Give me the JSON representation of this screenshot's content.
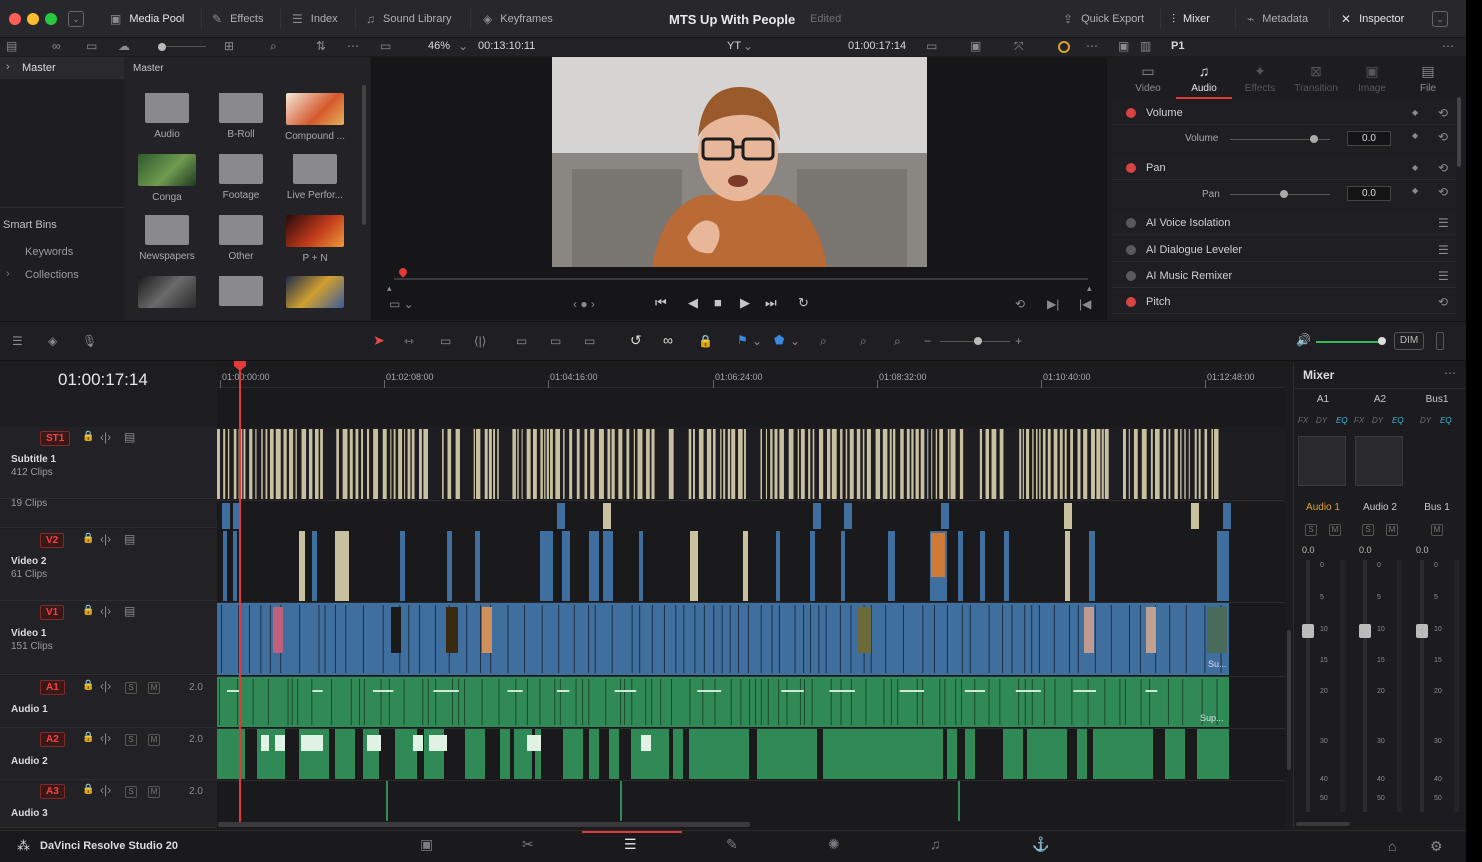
{
  "window": {
    "traffic_lights": [
      "#ff5f57",
      "#febc2e",
      "#28c840"
    ]
  },
  "topbar": {
    "media_pool": "Media Pool",
    "effects": "Effects",
    "index": "Index",
    "sound_library": "Sound Library",
    "keyframes": "Keyframes",
    "project_title": "MTS Up With People",
    "status": "Edited",
    "quick_export": "Quick Export",
    "mixer": "Mixer",
    "metadata": "Metadata",
    "inspector": "Inspector"
  },
  "viewer_bar": {
    "zoom": "46%",
    "source_tc": "00:13:10:11",
    "preset": "YT",
    "record_tc": "01:00:17:14",
    "clip_label": "P1"
  },
  "media_pool": {
    "root": "Master",
    "header": "Master",
    "smart_bins": "Smart Bins",
    "keywords": "Keywords",
    "collections": "Collections",
    "bins": [
      {
        "label": "Audio",
        "kind": "folder"
      },
      {
        "label": "B-Roll",
        "kind": "folder"
      },
      {
        "label": "Compound ...",
        "kind": "thumb-comp"
      },
      {
        "label": "Conga",
        "kind": "thumb-green"
      },
      {
        "label": "Footage",
        "kind": "folder"
      },
      {
        "label": "Live Perfor...",
        "kind": "folder"
      },
      {
        "label": "Newspapers",
        "kind": "folder"
      },
      {
        "label": "Other",
        "kind": "folder"
      },
      {
        "label": "P + N",
        "kind": "thumb-red"
      }
    ]
  },
  "inspector": {
    "tabs": [
      "Video",
      "Audio",
      "Effects",
      "Transition",
      "Image",
      "File"
    ],
    "active_tab": "Audio",
    "sections": {
      "volume": "Volume",
      "volume_param": "Volume",
      "volume_value": "0.0",
      "pan": "Pan",
      "pan_param": "Pan",
      "pan_value": "0.0",
      "voice_isolation": "AI Voice Isolation",
      "dialogue_leveler": "AI Dialogue Leveler",
      "music_remixer": "AI Music Remixer",
      "pitch": "Pitch"
    }
  },
  "timeline": {
    "timecode": "01:00:17:14",
    "ruler": [
      "01:00:00:00",
      "01:02:08:00",
      "01:04:16:00",
      "01:06:24:00",
      "01:08:32:00",
      "01:10:40:00",
      "01:12:48:00"
    ],
    "tracks": [
      {
        "tag": "ST1",
        "name": "Subtitle 1",
        "sub": "412 Clips"
      },
      {
        "tag": "",
        "name": "",
        "sub": "19 Clips"
      },
      {
        "tag": "V2",
        "name": "Video 2",
        "sub": "61 Clips"
      },
      {
        "tag": "V1",
        "name": "Video 1",
        "sub": "151 Clips"
      },
      {
        "tag": "A1",
        "name": "Audio 1",
        "level": "2.0"
      },
      {
        "tag": "A2",
        "name": "Audio 2",
        "level": "2.0"
      },
      {
        "tag": "A3",
        "name": "Audio 3",
        "level": "2.0"
      }
    ],
    "clip_labels": {
      "v1_end": "Su...",
      "a1_end": "Sup..."
    },
    "solo": "S",
    "mute": "M"
  },
  "mixer": {
    "title": "Mixer",
    "dim": "DIM",
    "channels": [
      "A1",
      "A2",
      "Bus1"
    ],
    "fx_row": [
      "FX",
      "DY",
      "EQ",
      "FX",
      "DY",
      "EQ",
      "DY",
      "EQ"
    ],
    "names": [
      "Audio 1",
      "Audio 2",
      "Bus 1"
    ],
    "values": [
      "0.0",
      "0.0",
      "0.0"
    ],
    "scale": [
      "0",
      "5",
      "10",
      "15",
      "20",
      "30",
      "40",
      "50"
    ],
    "solo": "S",
    "mute": "M"
  },
  "bottom": {
    "app_name": "DaVinci Resolve Studio 20",
    "pages": [
      "media",
      "cut",
      "edit",
      "fusion",
      "color",
      "fairlight",
      "deliver"
    ],
    "active_page": "edit"
  },
  "colors": {
    "playhead": "#e23a3a",
    "video_clip": "#3f6f9f",
    "audio_clip": "#2f8a55",
    "subtitle_clip": "#c9c0a0",
    "accent_orange": "#e0a030",
    "accent_cyan": "#3ab8d6"
  }
}
